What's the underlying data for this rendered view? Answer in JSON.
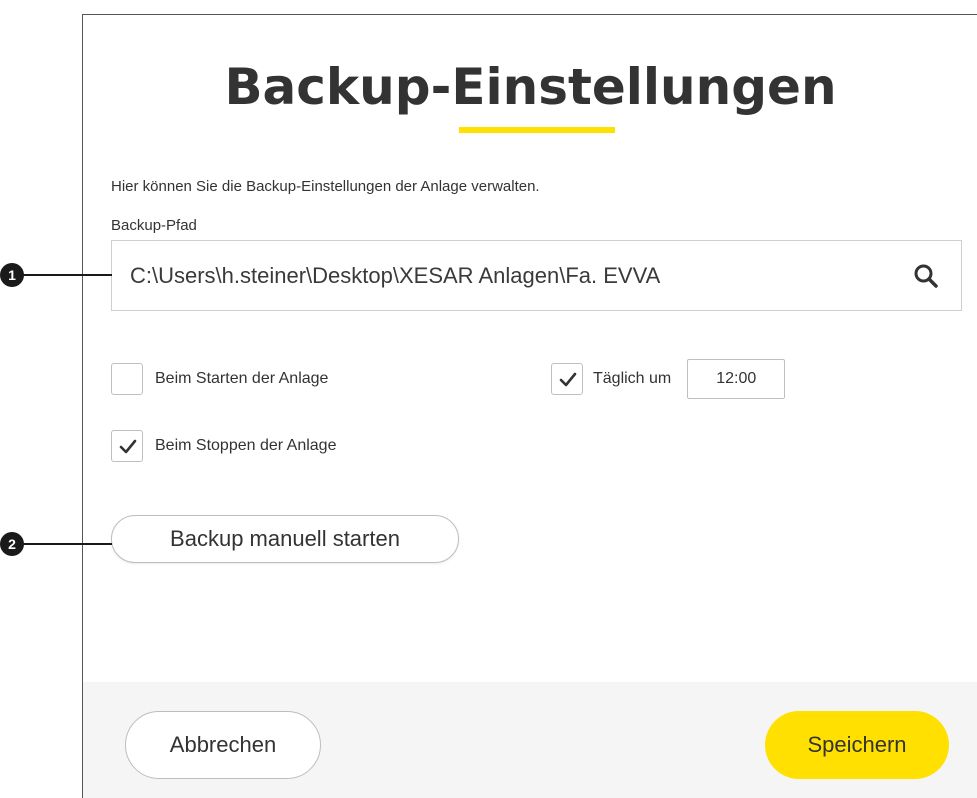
{
  "dialog": {
    "title": "Backup-Einstellungen",
    "description": "Hier können Sie die Backup-Einstellungen der Anlage verwalten.",
    "path_label": "Backup-Pfad",
    "path_value": "C:\\Users\\h.steiner\\Desktop\\XESAR Anlagen\\Fa. EVVA",
    "options": {
      "on_start": {
        "label": "Beim Starten der Anlage",
        "checked": false
      },
      "daily": {
        "label": "Täglich um",
        "checked": true,
        "time": "12:00"
      },
      "on_stop": {
        "label": "Beim Stoppen der Anlage",
        "checked": true
      }
    },
    "manual_button": "Backup manuell starten",
    "cancel_button": "Abbrechen",
    "save_button": "Speichern"
  },
  "callouts": {
    "one": "1",
    "two": "2"
  },
  "icons": {
    "search": "search-icon",
    "check": "check-icon"
  },
  "colors": {
    "accent": "#ffe000",
    "text": "#333333",
    "footer_bg": "#f5f5f5"
  }
}
